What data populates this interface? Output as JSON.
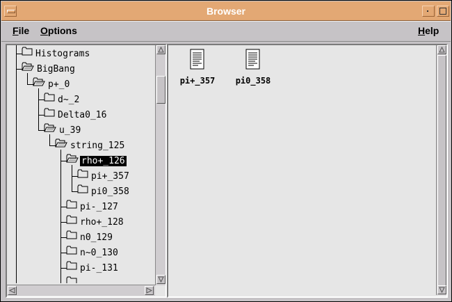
{
  "window": {
    "title": "Browser"
  },
  "menu": {
    "file": {
      "mnemonic": "F",
      "rest": "ile"
    },
    "options": {
      "mnemonic": "O",
      "rest": "ptions"
    },
    "help": {
      "mnemonic": "H",
      "rest": "elp"
    }
  },
  "tree": {
    "items": [
      {
        "label": "Histograms",
        "depth": 0,
        "icon": "folder-closed-icon"
      },
      {
        "label": "BigBang",
        "depth": 0,
        "icon": "folder-open-icon"
      },
      {
        "label": "p+_0",
        "depth": 1,
        "icon": "folder-open-icon"
      },
      {
        "label": "d~_2",
        "depth": 2,
        "icon": "folder-closed-icon"
      },
      {
        "label": "Delta0_16",
        "depth": 2,
        "icon": "folder-closed-icon"
      },
      {
        "label": "u_39",
        "depth": 2,
        "icon": "folder-open-icon"
      },
      {
        "label": "string_125",
        "depth": 3,
        "icon": "folder-open-icon"
      },
      {
        "label": "rho+_126",
        "depth": 4,
        "icon": "folder-open-icon",
        "selected": true
      },
      {
        "label": "pi+_357",
        "depth": 5,
        "icon": "folder-closed-icon"
      },
      {
        "label": "pi0_358",
        "depth": 5,
        "icon": "folder-closed-icon"
      },
      {
        "label": "pi-_127",
        "depth": 4,
        "icon": "folder-closed-icon"
      },
      {
        "label": "rho+_128",
        "depth": 4,
        "icon": "folder-closed-icon"
      },
      {
        "label": "n0_129",
        "depth": 4,
        "icon": "folder-closed-icon"
      },
      {
        "label": "n~0_130",
        "depth": 4,
        "icon": "folder-closed-icon"
      },
      {
        "label": "pi-_131",
        "depth": 4,
        "icon": "folder-closed-icon"
      },
      {
        "label": "",
        "depth": 4,
        "icon": "folder-closed-icon"
      }
    ]
  },
  "files": [
    {
      "name": "pi+_357",
      "icon": "document-icon"
    },
    {
      "name": "pi0_358",
      "icon": "document-icon"
    }
  ],
  "colors": {
    "titlebar": "#e3a874",
    "selection": "#000000",
    "pane": "#e6e6e6"
  }
}
